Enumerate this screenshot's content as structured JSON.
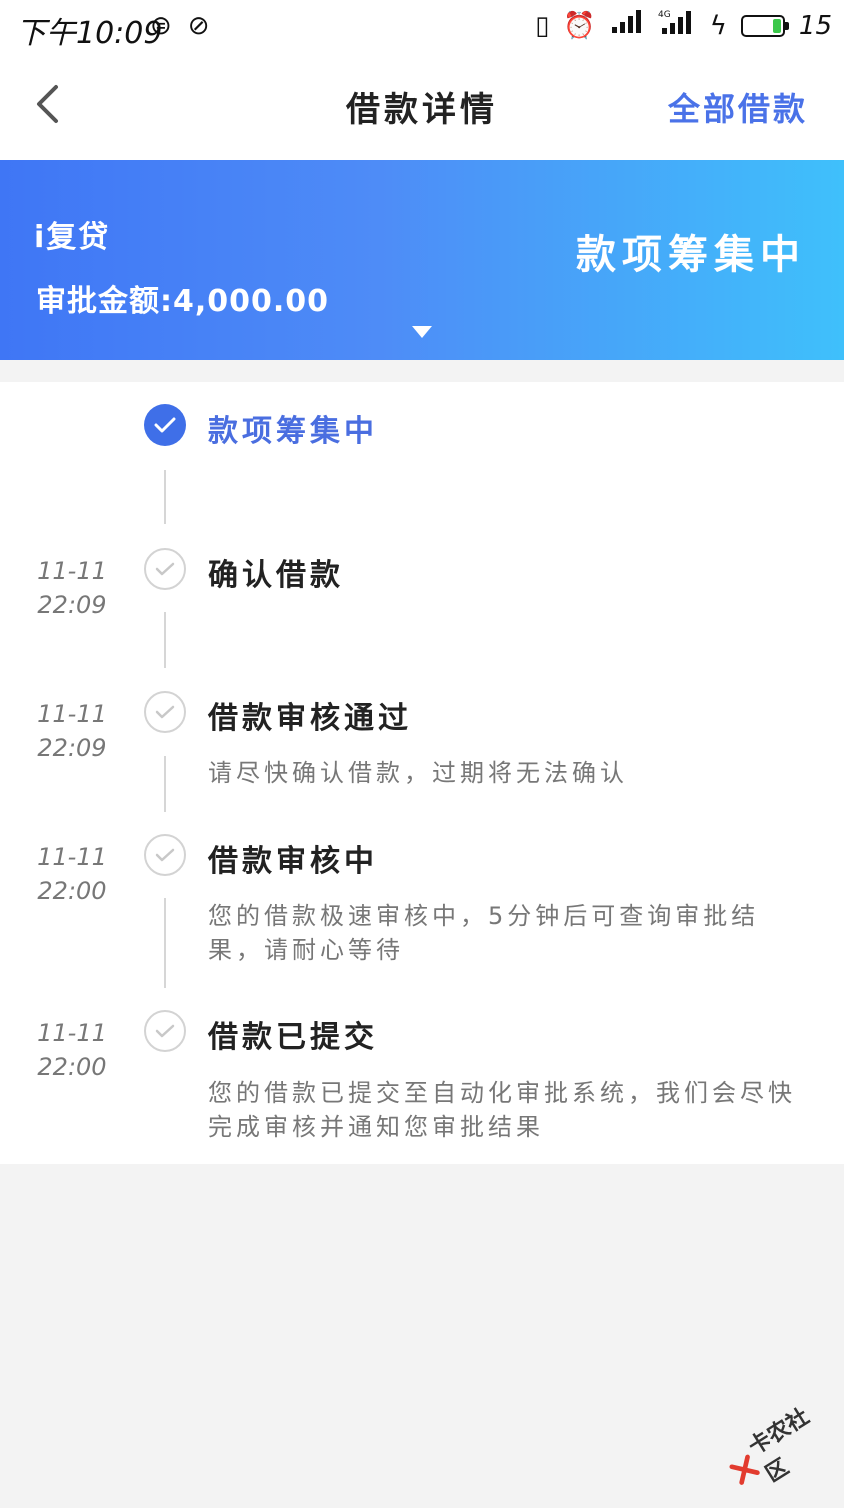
{
  "status_bar": {
    "time": "下午10:09",
    "battery_level": "15",
    "icons": [
      "sync-icon",
      "no-disturb-icon",
      "vibrate-icon",
      "alarm-icon",
      "signal-icon",
      "4g-signal-icon",
      "charging-icon",
      "battery-icon"
    ]
  },
  "header": {
    "title": "借款详情",
    "right_link": "全部借款",
    "back_icon": "chevron-left-icon"
  },
  "banner": {
    "product_name": "i复贷",
    "approval_amount": "审批金额:4,000.00",
    "status": "款项筹集中",
    "expand_icon": "caret-down-icon"
  },
  "timeline": [
    {
      "date_day": "",
      "date_time": "",
      "title": "款项筹集中",
      "desc": "",
      "state": "active"
    },
    {
      "date_day": "11-11",
      "date_time": "22:09",
      "title": "确认借款",
      "desc": "",
      "state": "done"
    },
    {
      "date_day": "11-11",
      "date_time": "22:09",
      "title": "借款审核通过",
      "desc": "请尽快确认借款，过期将无法确认",
      "state": "done"
    },
    {
      "date_day": "11-11",
      "date_time": "22:00",
      "title": "借款审核中",
      "desc": "您的借款极速审核中，5分钟后可查询审批结果，请耐心等待",
      "state": "done"
    },
    {
      "date_day": "11-11",
      "date_time": "22:00",
      "title": "借款已提交",
      "desc": "您的借款已提交至自动化审批系统，我们会尽快完成审核并通知您审批结果",
      "state": "done"
    }
  ],
  "watermark": {
    "text": "卡农社区"
  },
  "colors": {
    "accent": "#4a6ee0",
    "banner_start": "#3f76f5",
    "banner_end": "#3fc0fb"
  }
}
